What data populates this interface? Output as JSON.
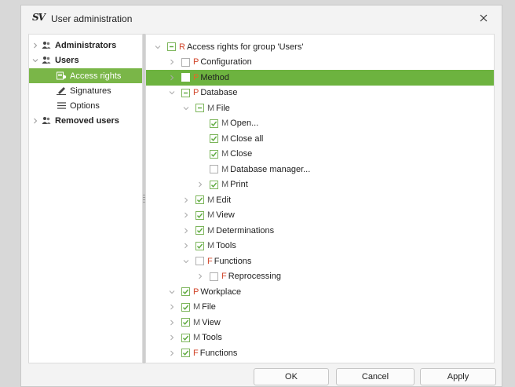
{
  "window": {
    "logo": "SV",
    "title": "User administration"
  },
  "left_tree": [
    {
      "label": "Administrators",
      "bold": true
    },
    {
      "label": "Users",
      "bold": true
    },
    {
      "label": "Access rights",
      "selected": true
    },
    {
      "label": "Signatures"
    },
    {
      "label": "Options"
    },
    {
      "label": "Removed users",
      "bold": true
    }
  ],
  "tree": [
    {
      "prefix": "R",
      "label": "Access rights for group 'Users'",
      "state": "partial",
      "expanded": true
    },
    {
      "prefix": "P",
      "label": "Configuration",
      "state": "unchecked"
    },
    {
      "prefix": "P",
      "label": "Method",
      "state": "unchecked",
      "selected": true
    },
    {
      "prefix": "P",
      "label": "Database",
      "state": "partial",
      "expanded": true
    },
    {
      "prefix": "M",
      "label": "File",
      "state": "partial",
      "expanded": true
    },
    {
      "prefix": "M",
      "label": "Open...",
      "state": "checked"
    },
    {
      "prefix": "M",
      "label": "Close all",
      "state": "checked"
    },
    {
      "prefix": "M",
      "label": "Close",
      "state": "checked"
    },
    {
      "prefix": "M",
      "label": "Database manager...",
      "state": "unchecked"
    },
    {
      "prefix": "M",
      "label": "Print",
      "state": "checked"
    },
    {
      "prefix": "M",
      "label": "Edit",
      "state": "checked"
    },
    {
      "prefix": "M",
      "label": "View",
      "state": "checked"
    },
    {
      "prefix": "M",
      "label": "Determinations",
      "state": "checked"
    },
    {
      "prefix": "M",
      "label": "Tools",
      "state": "checked"
    },
    {
      "prefix": "F",
      "label": "Functions",
      "state": "unchecked",
      "expanded": true
    },
    {
      "prefix": "F",
      "label": "Reprocessing",
      "state": "unchecked"
    },
    {
      "prefix": "P",
      "label": "Workplace",
      "state": "checked",
      "expanded": true
    },
    {
      "prefix": "M",
      "label": "File",
      "state": "checked"
    },
    {
      "prefix": "M",
      "label": "View",
      "state": "checked"
    },
    {
      "prefix": "M",
      "label": "Tools",
      "state": "checked"
    },
    {
      "prefix": "F",
      "label": "Functions",
      "state": "checked"
    }
  ],
  "buttons": {
    "ok": "OK",
    "cancel": "Cancel",
    "apply": "Apply"
  },
  "colors": {
    "selection": "#7ab648",
    "check": "#5aa83a",
    "prefix_red": "#d2462b"
  }
}
